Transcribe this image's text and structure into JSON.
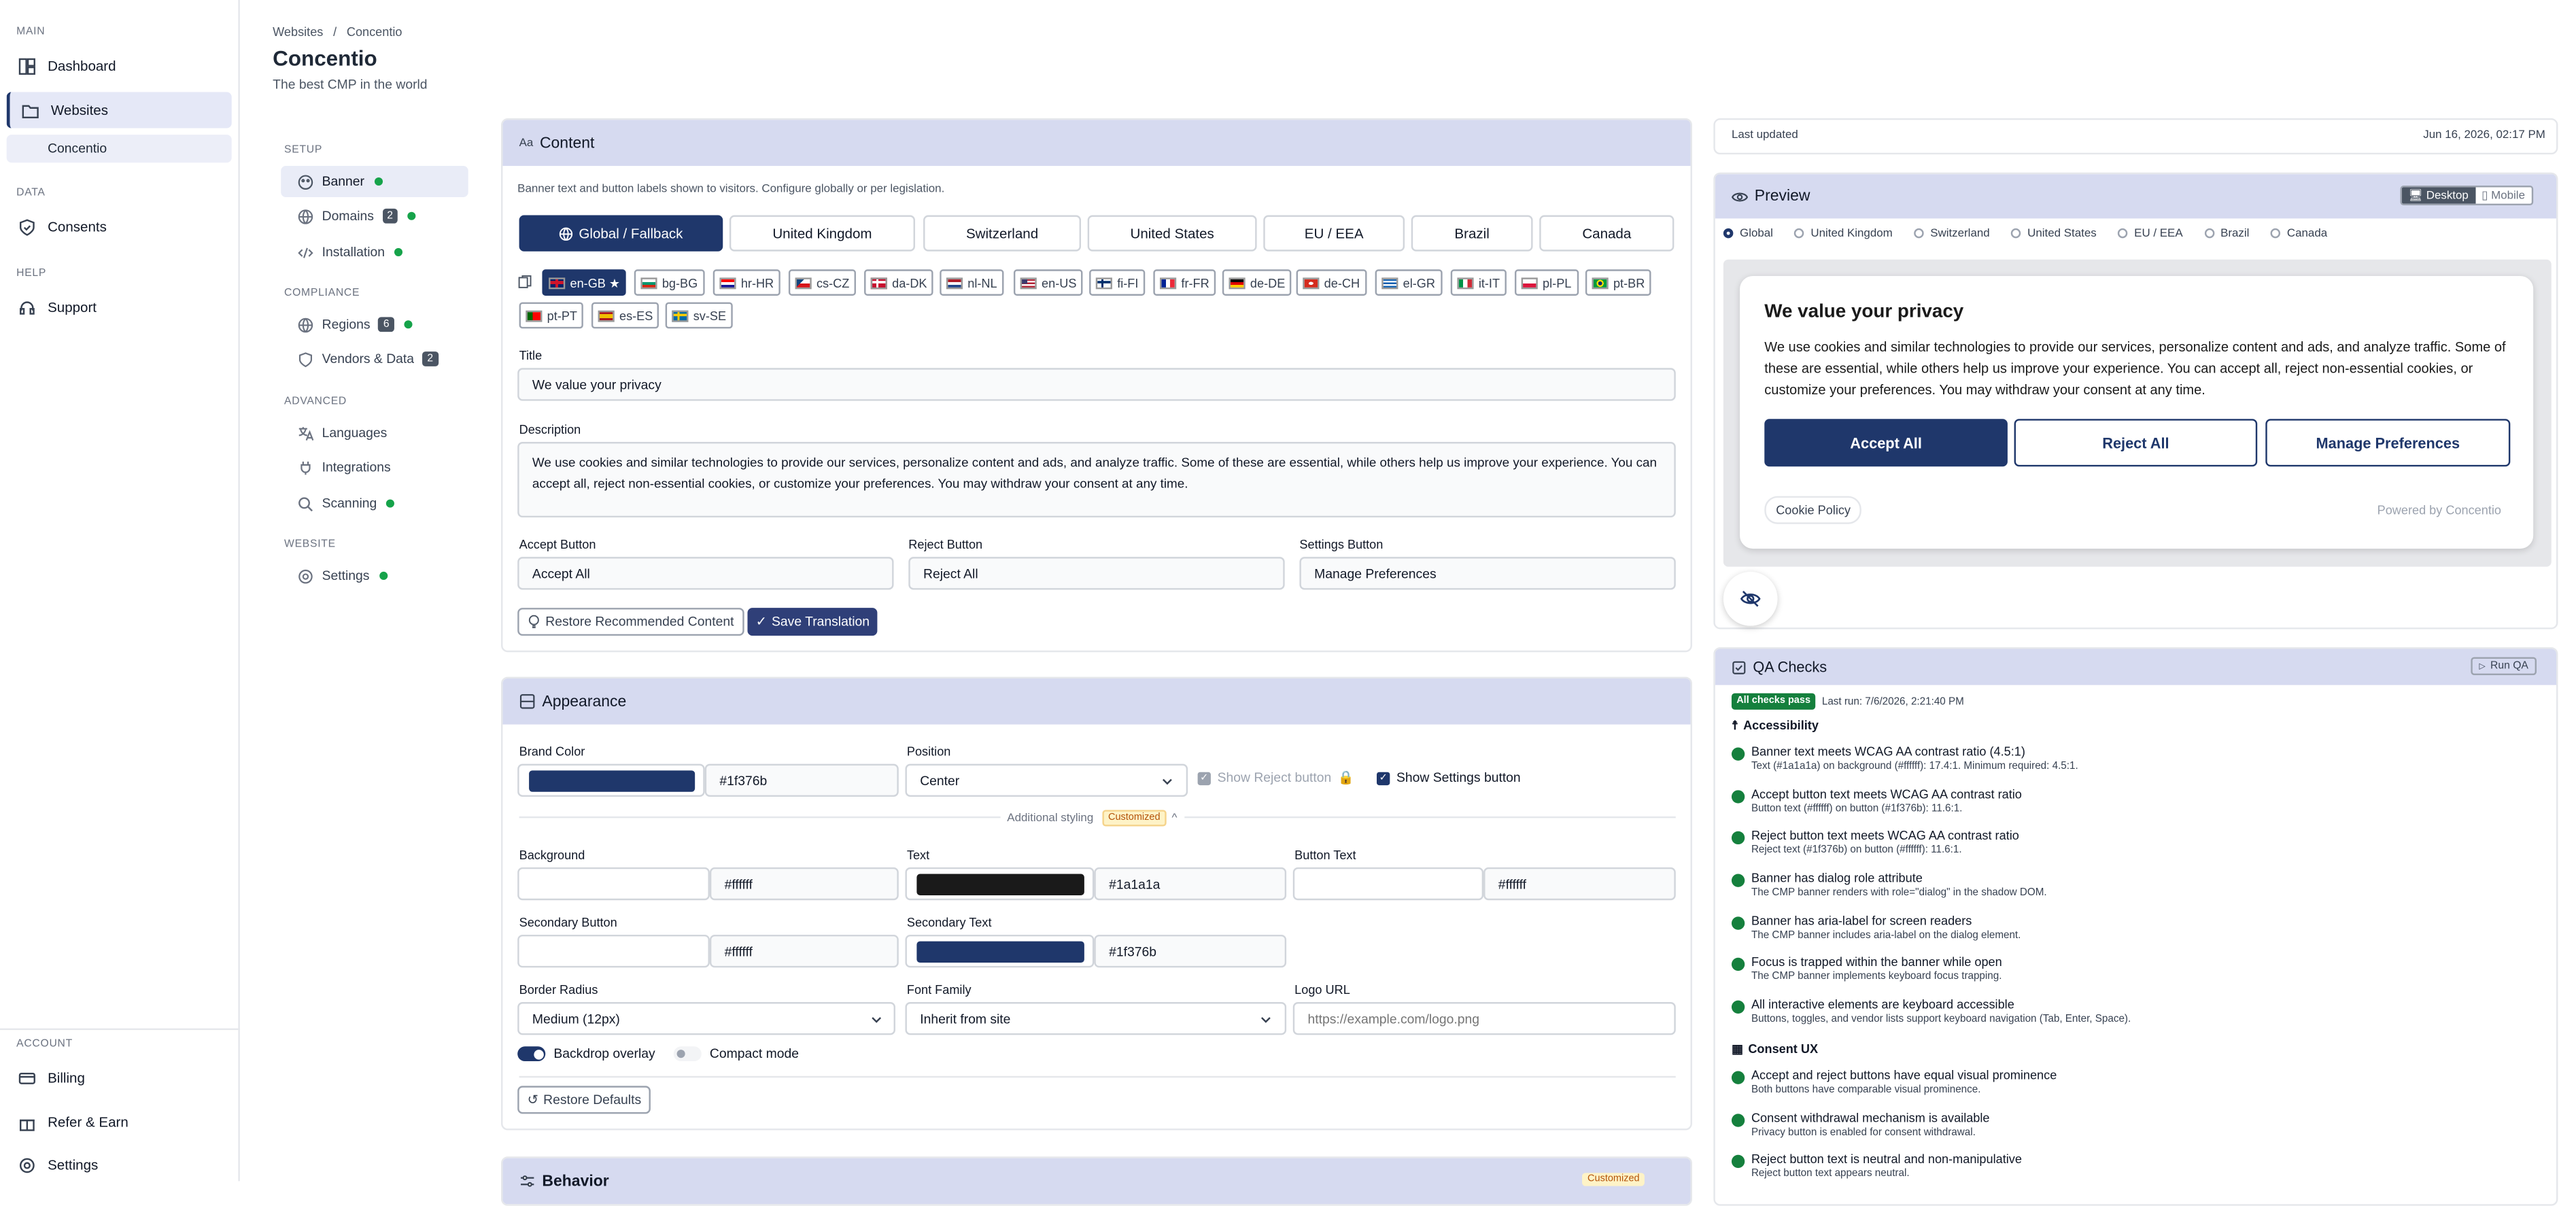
{
  "nav": {
    "sections": {
      "main": "MAIN",
      "data": "DATA",
      "help": "HELP",
      "account": "ACCOUNT"
    },
    "dashboard": "Dashboard",
    "websites": "Websites",
    "website_sub": "Concentio",
    "consents": "Consents",
    "support": "Support",
    "billing": "Billing",
    "refer": "Refer & Earn",
    "settings": "Settings"
  },
  "header": {
    "crumb_root": "Websites",
    "crumb_sep": "/",
    "crumb_current": "Concentio",
    "title": "Concentio",
    "subtitle": "The best CMP in the world"
  },
  "subnav": {
    "setup": "SETUP",
    "compliance": "COMPLIANCE",
    "advanced": "ADVANCED",
    "website": "WEBSITE",
    "banner": "Banner",
    "domains": "Domains",
    "domains_count": "2",
    "installation": "Installation",
    "regions": "Regions",
    "regions_count": "6",
    "vendors": "Vendors & Data",
    "vendors_count": "2",
    "languages": "Languages",
    "integrations": "Integrations",
    "scanning": "Scanning",
    "settings": "Settings"
  },
  "content": {
    "header": "Content",
    "hint": "Banner text and button labels shown to visitors. Configure globally or per legislation.",
    "tabs": [
      "Global / Fallback",
      "United Kingdom",
      "Switzerland",
      "United States",
      "EU / EEA",
      "Brazil",
      "Canada"
    ],
    "locales": [
      "en-GB ★",
      "bg-BG",
      "hr-HR",
      "cs-CZ",
      "da-DK",
      "nl-NL",
      "en-US",
      "fi-FI",
      "fr-FR",
      "de-DE",
      "de-CH",
      "el-GR",
      "it-IT",
      "pl-PL",
      "pt-BR",
      "pt-PT",
      "es-ES",
      "sv-SE"
    ],
    "title_label": "Title",
    "title_value": "We value your privacy",
    "desc_label": "Description",
    "desc_value": "We use cookies and similar technologies to provide our services, personalize content and ads, and analyze traffic. Some of these are essential, while others help us improve your experience. You can accept all, reject non-essential cookies, or customize your preferences. You may withdraw your consent at any time.",
    "accept_label": "Accept Button",
    "accept_value": "Accept All",
    "reject_label": "Reject Button",
    "reject_value": "Reject All",
    "settings_label": "Settings Button",
    "settings_value": "Manage Preferences",
    "restore_btn": "Restore Recommended Content",
    "save_btn": "Save Translation"
  },
  "appearance": {
    "header": "Appearance",
    "brand_label": "Brand Color",
    "brand_hex": "#1f376b",
    "position_label": "Position",
    "position_value": "Center",
    "show_reject": "Show Reject button",
    "show_settings": "Show Settings button",
    "additional": "Additional styling",
    "customized": "Customized",
    "bg_label": "Background",
    "bg_hex": "#ffffff",
    "text_label": "Text",
    "text_hex": "#1a1a1a",
    "btntext_label": "Button Text",
    "btntext_hex": "#ffffff",
    "secbtn_label": "Secondary Button",
    "secbtn_hex": "#ffffff",
    "sectext_label": "Secondary Text",
    "sectext_hex": "#1f376b",
    "radius_label": "Border Radius",
    "radius_value": "Medium (12px)",
    "font_label": "Font Family",
    "font_value": "Inherit from site",
    "logo_label": "Logo URL",
    "logo_placeholder": "https://example.com/logo.png",
    "backdrop": "Backdrop overlay",
    "compact": "Compact mode",
    "restore_defaults": "Restore Defaults"
  },
  "behavior": {
    "header": "Behavior",
    "customized": "Customized"
  },
  "right": {
    "last_updated_label": "Last updated",
    "last_updated_value": "Jun 16, 2026, 02:17 PM",
    "preview_header": "Preview",
    "desktop": "Desktop",
    "mobile": "Mobile",
    "regions": [
      "Global",
      "United Kingdom",
      "Switzerland",
      "United States",
      "EU / EEA",
      "Brazil",
      "Canada"
    ],
    "banner_title": "We value your privacy",
    "banner_text": "We use cookies and similar technologies to provide our services, personalize content and ads, and analyze traffic. Some of these are essential, while others help us improve your experience. You can accept all, reject non-essential cookies, or customize your preferences. You may withdraw your consent at any time.",
    "accept": "Accept All",
    "reject": "Reject All",
    "manage": "Manage Preferences",
    "cookie_policy": "Cookie Policy",
    "powered": "Powered by Concentio",
    "qa_header": "QA Checks",
    "run_qa": "Run QA",
    "all_pass": "All checks pass",
    "last_run": "Last run: 7/6/2026, 2:21:40 PM",
    "accessibility": "Accessibility",
    "consent_ux": "Consent UX",
    "checks": [
      {
        "t": "Banner text meets WCAG AA contrast ratio (4.5:1)",
        "d": "Text (#1a1a1a) on background (#ffffff): 17.4:1. Minimum required: 4.5:1."
      },
      {
        "t": "Accept button text meets WCAG AA contrast ratio",
        "d": "Button text (#ffffff) on button (#1f376b): 11.6:1."
      },
      {
        "t": "Reject button text meets WCAG AA contrast ratio",
        "d": "Reject text (#1f376b) on button (#ffffff): 11.6:1."
      },
      {
        "t": "Banner has dialog role attribute",
        "d": "The CMP banner renders with role=\"dialog\" in the shadow DOM."
      },
      {
        "t": "Banner has aria-label for screen readers",
        "d": "The CMP banner includes aria-label on the dialog element."
      },
      {
        "t": "Focus is trapped within the banner while open",
        "d": "The CMP banner implements keyboard focus trapping."
      },
      {
        "t": "All interactive elements are keyboard accessible",
        "d": "Buttons, toggles, and vendor lists support keyboard navigation (Tab, Enter, Space)."
      },
      {
        "t": "Accept and reject buttons have equal visual prominence",
        "d": "Both buttons have comparable visual prominence."
      },
      {
        "t": "Consent withdrawal mechanism is available",
        "d": "Privacy button is enabled for consent withdrawal."
      },
      {
        "t": "Reject button text is neutral and non-manipulative",
        "d": "Reject button text appears neutral."
      }
    ]
  },
  "colors": {
    "brand": "#1f376b",
    "header_bg": "#d6daf0",
    "pass": "#15803d"
  }
}
